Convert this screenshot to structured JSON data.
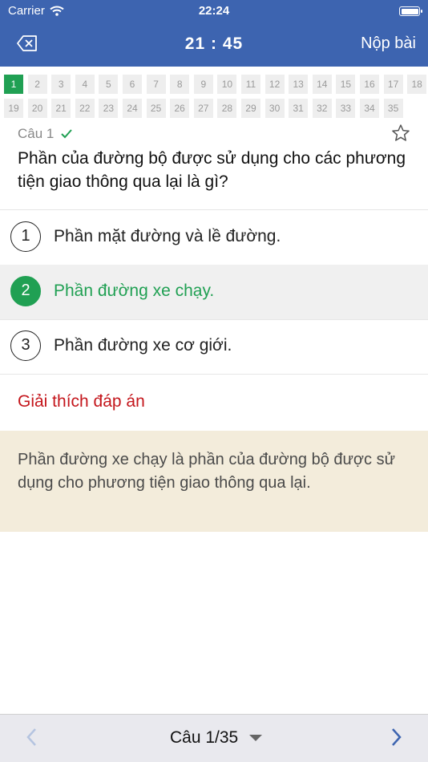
{
  "status": {
    "carrier": "Carrier",
    "time": "22:24"
  },
  "header": {
    "timer": "21 : 45",
    "submit_label": "Nộp bài"
  },
  "question_grid": {
    "active": 1,
    "row1": [
      "1",
      "2",
      "3",
      "4",
      "5",
      "6",
      "7",
      "8",
      "9",
      "10",
      "11",
      "12",
      "13",
      "14",
      "15",
      "16",
      "17",
      "18"
    ],
    "row2": [
      "19",
      "20",
      "21",
      "22",
      "23",
      "24",
      "25",
      "26",
      "27",
      "28",
      "29",
      "30",
      "31",
      "32",
      "33",
      "34",
      "35"
    ]
  },
  "question": {
    "label": "Câu 1",
    "text": "Phần của đường bộ được sử dụng cho các phương tiện giao thông qua lại là gì?"
  },
  "answers": [
    {
      "num": "1",
      "text": "Phần mặt đường và lề đường."
    },
    {
      "num": "2",
      "text": "Phần đường xe chạy."
    },
    {
      "num": "3",
      "text": "Phần đường xe cơ giới."
    }
  ],
  "selected_answer": 2,
  "explanation": {
    "title": "Giải thích đáp án",
    "text": "Phần đường xe chạy là phần của đường bộ được sử dụng cho phương tiện giao thông qua lại."
  },
  "footer": {
    "pager": "Câu 1/35"
  },
  "colors": {
    "header": "#3d64b0",
    "correct": "#20a053",
    "explain_title": "#c4161c",
    "explain_bg": "#f3ecdb"
  }
}
